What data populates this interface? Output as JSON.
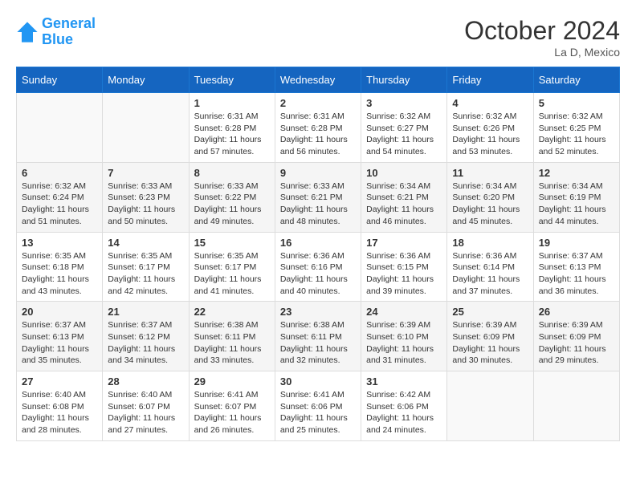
{
  "header": {
    "logo_line1": "General",
    "logo_line2": "Blue",
    "month": "October 2024",
    "location": "La D, Mexico"
  },
  "weekdays": [
    "Sunday",
    "Monday",
    "Tuesday",
    "Wednesday",
    "Thursday",
    "Friday",
    "Saturday"
  ],
  "weeks": [
    [
      {
        "day": "",
        "info": ""
      },
      {
        "day": "",
        "info": ""
      },
      {
        "day": "1",
        "info": "Sunrise: 6:31 AM\nSunset: 6:28 PM\nDaylight: 11 hours and 57 minutes."
      },
      {
        "day": "2",
        "info": "Sunrise: 6:31 AM\nSunset: 6:28 PM\nDaylight: 11 hours and 56 minutes."
      },
      {
        "day": "3",
        "info": "Sunrise: 6:32 AM\nSunset: 6:27 PM\nDaylight: 11 hours and 54 minutes."
      },
      {
        "day": "4",
        "info": "Sunrise: 6:32 AM\nSunset: 6:26 PM\nDaylight: 11 hours and 53 minutes."
      },
      {
        "day": "5",
        "info": "Sunrise: 6:32 AM\nSunset: 6:25 PM\nDaylight: 11 hours and 52 minutes."
      }
    ],
    [
      {
        "day": "6",
        "info": "Sunrise: 6:32 AM\nSunset: 6:24 PM\nDaylight: 11 hours and 51 minutes."
      },
      {
        "day": "7",
        "info": "Sunrise: 6:33 AM\nSunset: 6:23 PM\nDaylight: 11 hours and 50 minutes."
      },
      {
        "day": "8",
        "info": "Sunrise: 6:33 AM\nSunset: 6:22 PM\nDaylight: 11 hours and 49 minutes."
      },
      {
        "day": "9",
        "info": "Sunrise: 6:33 AM\nSunset: 6:21 PM\nDaylight: 11 hours and 48 minutes."
      },
      {
        "day": "10",
        "info": "Sunrise: 6:34 AM\nSunset: 6:21 PM\nDaylight: 11 hours and 46 minutes."
      },
      {
        "day": "11",
        "info": "Sunrise: 6:34 AM\nSunset: 6:20 PM\nDaylight: 11 hours and 45 minutes."
      },
      {
        "day": "12",
        "info": "Sunrise: 6:34 AM\nSunset: 6:19 PM\nDaylight: 11 hours and 44 minutes."
      }
    ],
    [
      {
        "day": "13",
        "info": "Sunrise: 6:35 AM\nSunset: 6:18 PM\nDaylight: 11 hours and 43 minutes."
      },
      {
        "day": "14",
        "info": "Sunrise: 6:35 AM\nSunset: 6:17 PM\nDaylight: 11 hours and 42 minutes."
      },
      {
        "day": "15",
        "info": "Sunrise: 6:35 AM\nSunset: 6:17 PM\nDaylight: 11 hours and 41 minutes."
      },
      {
        "day": "16",
        "info": "Sunrise: 6:36 AM\nSunset: 6:16 PM\nDaylight: 11 hours and 40 minutes."
      },
      {
        "day": "17",
        "info": "Sunrise: 6:36 AM\nSunset: 6:15 PM\nDaylight: 11 hours and 39 minutes."
      },
      {
        "day": "18",
        "info": "Sunrise: 6:36 AM\nSunset: 6:14 PM\nDaylight: 11 hours and 37 minutes."
      },
      {
        "day": "19",
        "info": "Sunrise: 6:37 AM\nSunset: 6:13 PM\nDaylight: 11 hours and 36 minutes."
      }
    ],
    [
      {
        "day": "20",
        "info": "Sunrise: 6:37 AM\nSunset: 6:13 PM\nDaylight: 11 hours and 35 minutes."
      },
      {
        "day": "21",
        "info": "Sunrise: 6:37 AM\nSunset: 6:12 PM\nDaylight: 11 hours and 34 minutes."
      },
      {
        "day": "22",
        "info": "Sunrise: 6:38 AM\nSunset: 6:11 PM\nDaylight: 11 hours and 33 minutes."
      },
      {
        "day": "23",
        "info": "Sunrise: 6:38 AM\nSunset: 6:11 PM\nDaylight: 11 hours and 32 minutes."
      },
      {
        "day": "24",
        "info": "Sunrise: 6:39 AM\nSunset: 6:10 PM\nDaylight: 11 hours and 31 minutes."
      },
      {
        "day": "25",
        "info": "Sunrise: 6:39 AM\nSunset: 6:09 PM\nDaylight: 11 hours and 30 minutes."
      },
      {
        "day": "26",
        "info": "Sunrise: 6:39 AM\nSunset: 6:09 PM\nDaylight: 11 hours and 29 minutes."
      }
    ],
    [
      {
        "day": "27",
        "info": "Sunrise: 6:40 AM\nSunset: 6:08 PM\nDaylight: 11 hours and 28 minutes."
      },
      {
        "day": "28",
        "info": "Sunrise: 6:40 AM\nSunset: 6:07 PM\nDaylight: 11 hours and 27 minutes."
      },
      {
        "day": "29",
        "info": "Sunrise: 6:41 AM\nSunset: 6:07 PM\nDaylight: 11 hours and 26 minutes."
      },
      {
        "day": "30",
        "info": "Sunrise: 6:41 AM\nSunset: 6:06 PM\nDaylight: 11 hours and 25 minutes."
      },
      {
        "day": "31",
        "info": "Sunrise: 6:42 AM\nSunset: 6:06 PM\nDaylight: 11 hours and 24 minutes."
      },
      {
        "day": "",
        "info": ""
      },
      {
        "day": "",
        "info": ""
      }
    ]
  ]
}
